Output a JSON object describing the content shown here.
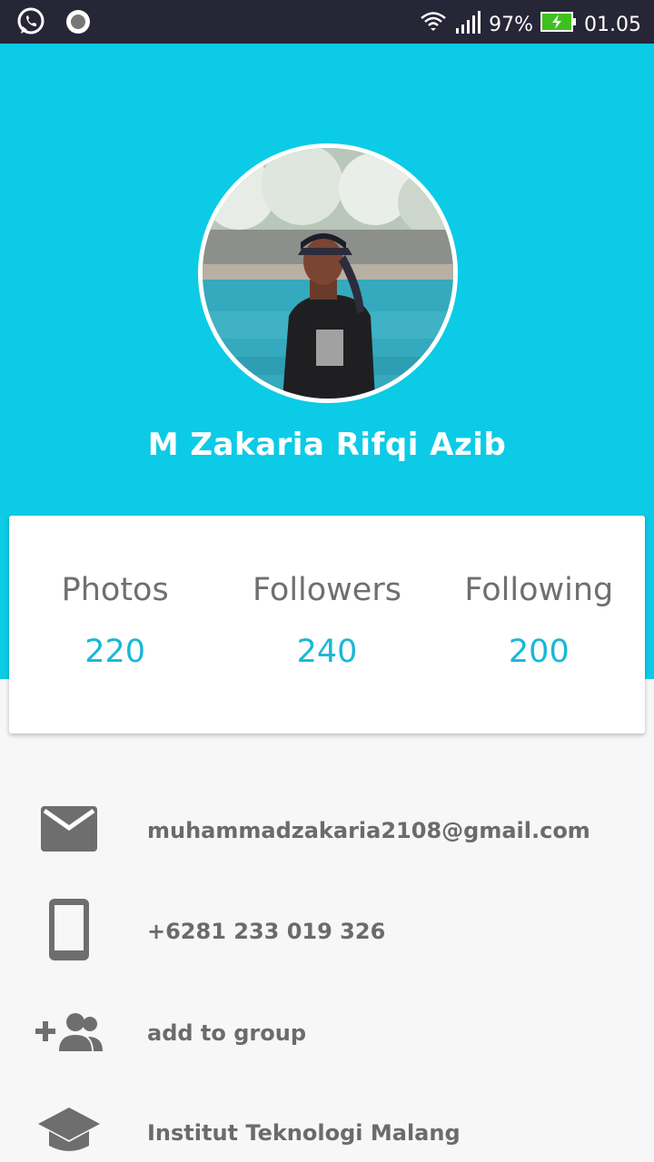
{
  "status_bar": {
    "battery": "97%",
    "time": "01.05",
    "icons": [
      "whatsapp-icon",
      "record-icon",
      "wifi-icon",
      "signal-icon",
      "battery-icon"
    ]
  },
  "profile": {
    "name": "M Zakaria Rifqi Azib",
    "avatar_icon": "profile-photo"
  },
  "stats": [
    {
      "label": "Photos",
      "value": "220"
    },
    {
      "label": "Followers",
      "value": "240"
    },
    {
      "label": "Following",
      "value": "200"
    }
  ],
  "info": {
    "email": "muhammadzakaria2108@gmail.com",
    "phone": "+6281 233 019 326",
    "group": "add to group",
    "school": "Institut Teknologi Malang"
  },
  "colors": {
    "accent": "#0ccbe6",
    "status_bar": "#262637",
    "stat_value": "#19b8d6",
    "text_gray": "#6b6b6b"
  }
}
